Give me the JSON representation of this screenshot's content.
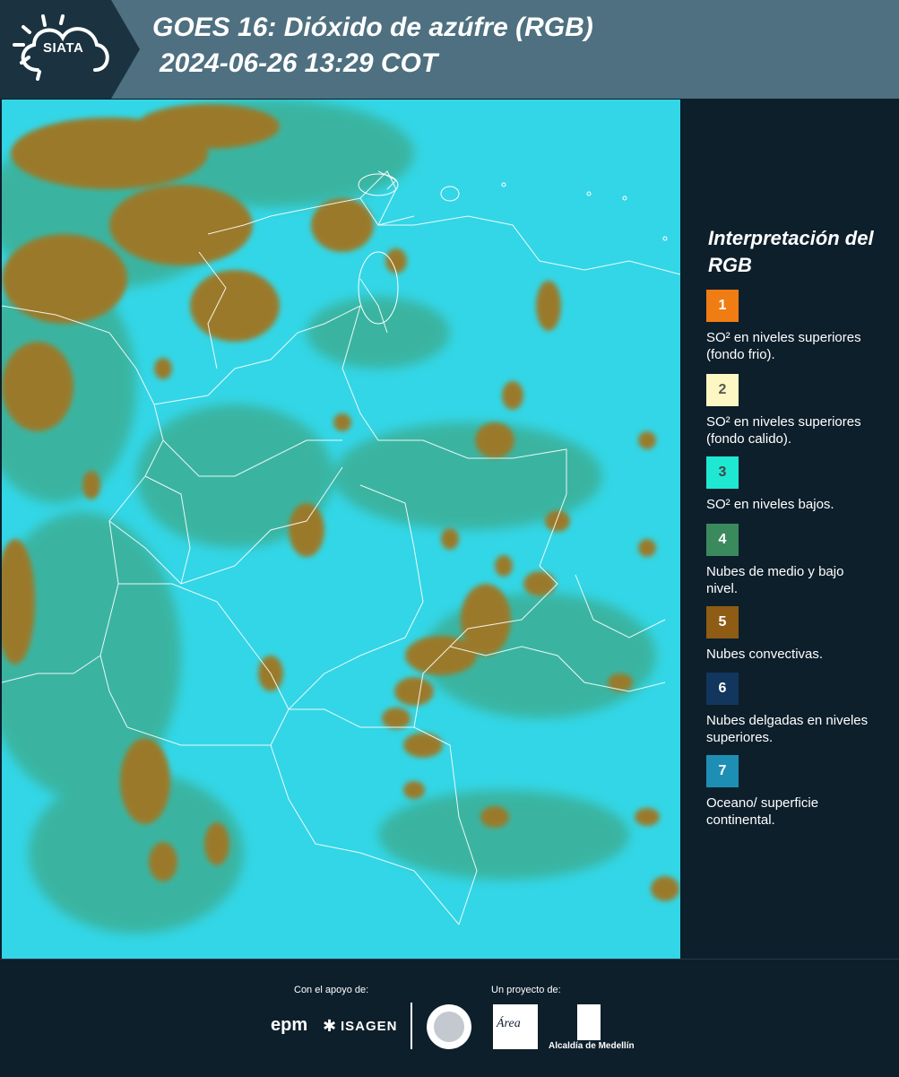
{
  "header": {
    "logo_text": "SIATA",
    "title_line1": "GOES 16: Dióxido de azúfre (RGB)",
    "title_line2": "2024-06-26 13:29 COT",
    "bg_color": "#4e7080",
    "logo_bg_color": "#1b3340"
  },
  "legend": {
    "title": "Interpretación del RGB",
    "items": [
      {
        "number": "1",
        "color": "#f07d14",
        "num_color": "#ffffff",
        "label": "SO² en niveles superiores (fondo frio)."
      },
      {
        "number": "2",
        "color": "#fdf7c3",
        "num_color": "#555555",
        "label": "SO² en niveles superiores (fondo calido)."
      },
      {
        "number": "3",
        "color": "#1ee8d2",
        "num_color": "#444444",
        "label": "SO² en niveles bajos."
      },
      {
        "number": "4",
        "color": "#3a8a5e",
        "num_color": "#ffffff",
        "label": "Nubes de medio y bajo nivel."
      },
      {
        "number": "5",
        "color": "#8e5c14",
        "num_color": "#ffffff",
        "label": "Nubes convectivas."
      },
      {
        "number": "6",
        "color": "#12365e",
        "num_color": "#ffffff",
        "label": "Nubes delgadas en niveles superiores."
      },
      {
        "number": "7",
        "color": "#1e8fb4",
        "num_color": "#ffffff",
        "label": "Oceano/ superficie continental."
      }
    ]
  },
  "map": {
    "background_color": "#33d6e6",
    "cloud_color": "#9a7a2c",
    "green_color": "#3f9a6a",
    "border_color": "#ffffff"
  },
  "footer": {
    "support_label": "Con el apoyo de:",
    "project_label": "Un proyecto de:",
    "sponsor1": "epm",
    "sponsor2": "ISAGEN",
    "partner1": "Área",
    "partner2": "Alcaldía de Medellín"
  }
}
